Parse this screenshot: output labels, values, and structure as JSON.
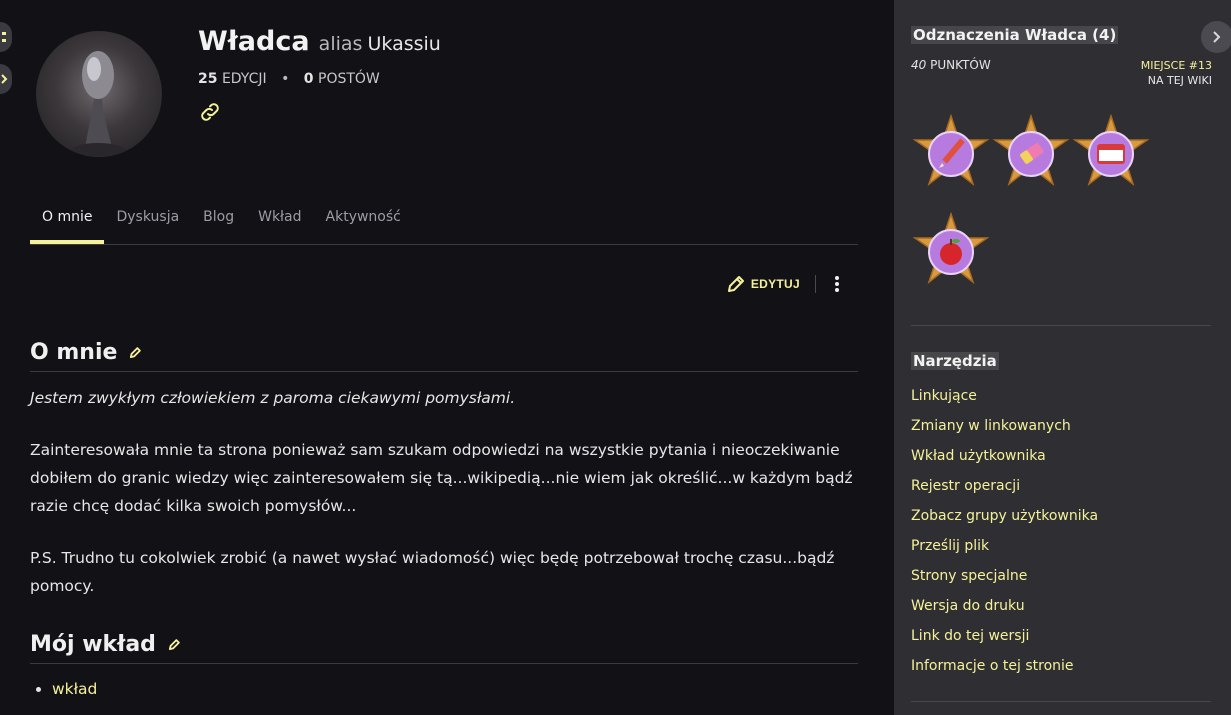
{
  "profile": {
    "name": "Władca",
    "alias_keyword": "alias",
    "alias": "Ukassiu",
    "edits_count": "25",
    "edits_label": "EDYCJI",
    "separator": "•",
    "posts_count": "0",
    "posts_label": "POSTÓW"
  },
  "tabs": [
    {
      "label": "O mnie",
      "active": true
    },
    {
      "label": "Dyskusja",
      "active": false
    },
    {
      "label": "Blog",
      "active": false
    },
    {
      "label": "Wkład",
      "active": false
    },
    {
      "label": "Aktywność",
      "active": false
    }
  ],
  "toolbar": {
    "edit_label": "EDYTUJ"
  },
  "content": {
    "about_heading": "O mnie",
    "intro": "Jestem zwykłym człowiekiem z paroma ciekawymi pomysłami.",
    "body": "Zainteresowała mnie ta strona ponieważ sam szukam odpowiedzi na wszystkie pytania i nieoczekiwanie dobiłem do granic wiedzy więc zainteresowałem się tą...wikipedią...nie wiem jak określić...w każdym bądź razie chcę dodać kilka swoich pomysłów...",
    "ps": "P.S. Trudno tu cokolwiek zrobić (a nawet wysłać wiadomość) więc będę potrzebował trochę czasu...bądź pomocy.",
    "contrib_heading": "Mój wkład",
    "contrib_items": [
      "wkład"
    ]
  },
  "sidebar": {
    "badges_title": "Odznaczenia Władca (4)",
    "points_value": "40",
    "points_label": "PUNKTÓW",
    "rank_place": "MIEJSCE #13",
    "rank_scope": "NA TEJ WIKI",
    "badges": [
      {
        "icon": "pencil-badge-icon"
      },
      {
        "icon": "eraser-badge-icon"
      },
      {
        "icon": "hello-name-tag-badge-icon"
      },
      {
        "icon": "apple-badge-icon"
      }
    ],
    "tools_title": "Narzędzia",
    "tools": [
      "Linkujące",
      "Zmiany w linkowanych",
      "Wkład użytkownika",
      "Rejestr operacji",
      "Zobacz grupy użytkownika",
      "Prześlij plik",
      "Strony specjalne",
      "Wersja do druku",
      "Link do tej wersji",
      "Informacje o tej stronie"
    ]
  },
  "colors": {
    "background": "#111116",
    "sidebar_bg": "#2f2f33",
    "accent": "#f5f19a",
    "text": "#e6e6e6"
  }
}
